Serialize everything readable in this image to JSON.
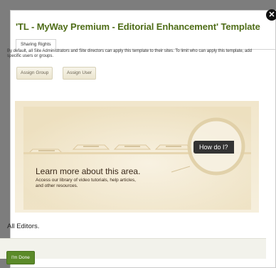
{
  "dialog": {
    "title": "'TL - MyWay Premium - Editorial Enhancement' Template",
    "close_glyph": "✕",
    "close_icon": "close-icon"
  },
  "tabs": [
    {
      "label": "Sharing Rights",
      "active": true
    }
  ],
  "sharing": {
    "description": "By default, all Site Administrators and Site directors can apply this template to their sites. To limit who can apply this template, add specific users or groups.",
    "assign_group_label": "Assign Group",
    "assign_user_label": "Assign User"
  },
  "promo": {
    "title": "Learn more about this area.",
    "subtitle": "Access our library of video tutorials, help articles, and other resources.",
    "how_do_label": "How do I?"
  },
  "editors_text": "All Editors.",
  "footer": {
    "done_label": "I'm Done"
  },
  "colors": {
    "title": "#4f6d18",
    "done_button": "#5b8a29",
    "promo_bg": "#eedfbd",
    "overlay": "#7d7d7d"
  }
}
